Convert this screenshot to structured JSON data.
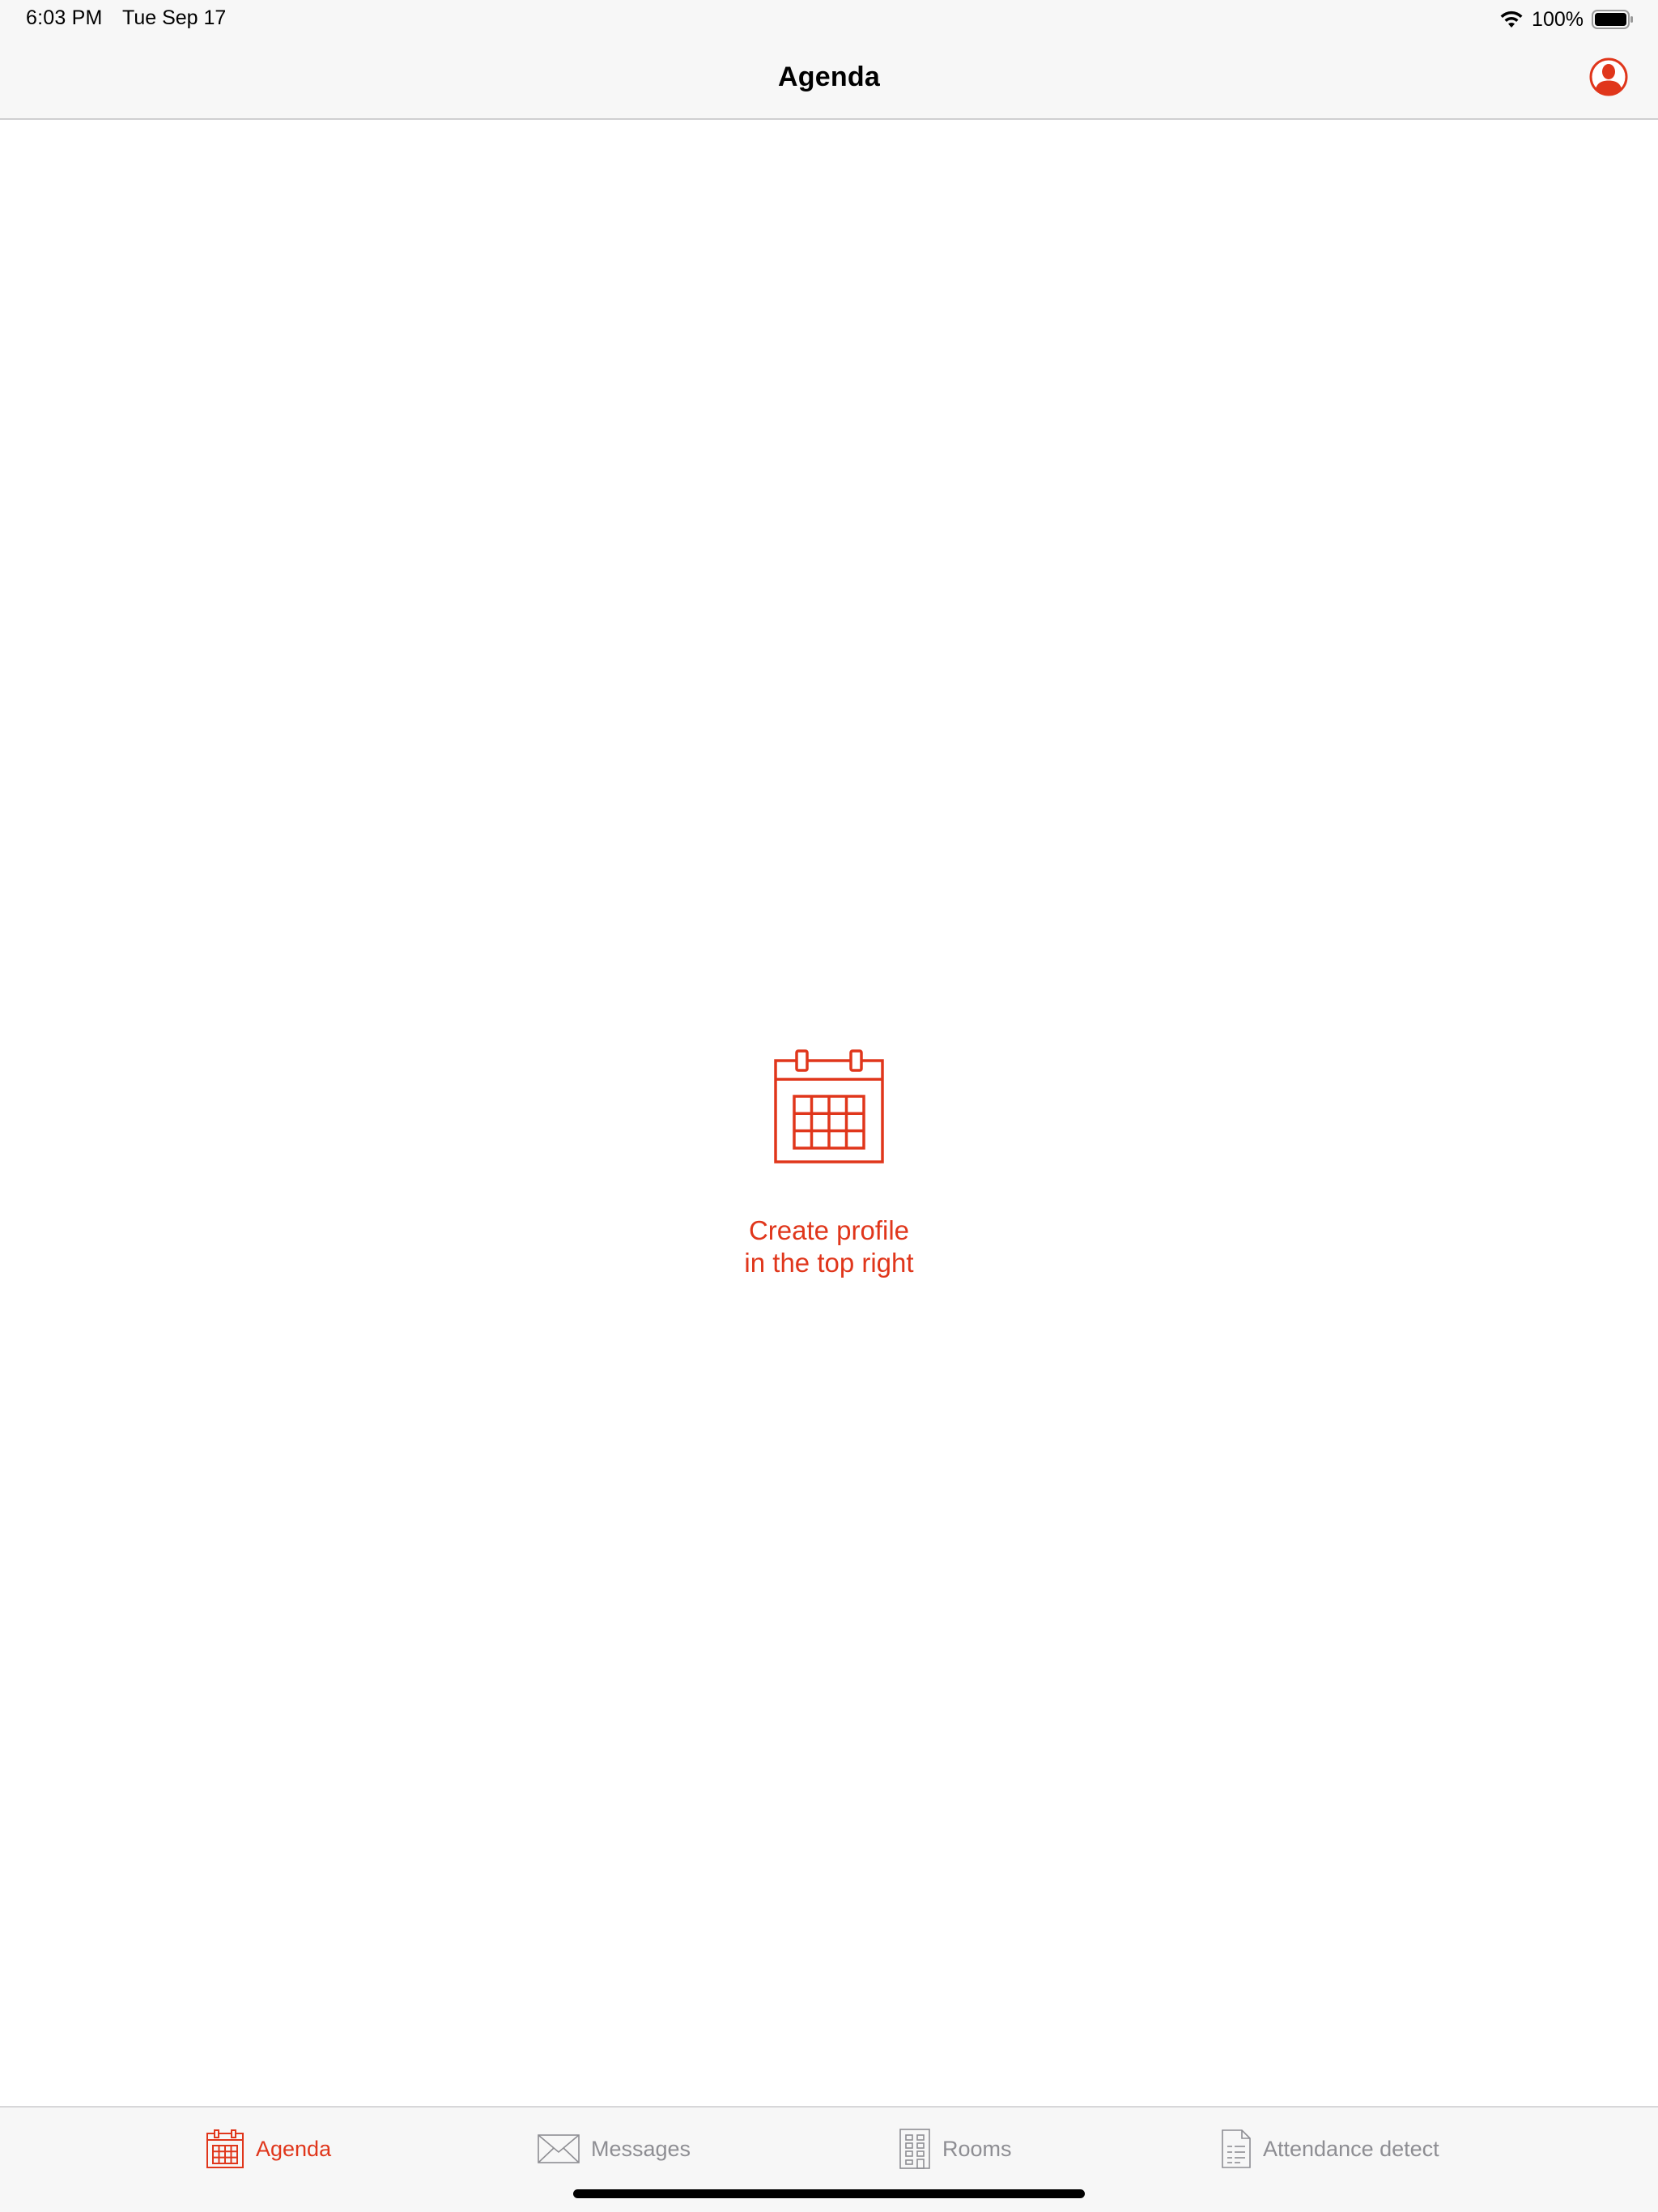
{
  "status_bar": {
    "time": "6:03 PM",
    "date": "Tue Sep 17",
    "battery_percent": "100%",
    "wifi_icon": "wifi-icon",
    "battery_icon": "battery-full-icon"
  },
  "nav": {
    "title": "Agenda",
    "profile_icon": "profile-icon"
  },
  "empty_state": {
    "icon": "calendar-icon",
    "line1": "Create profile",
    "line2": "in the top right"
  },
  "tabs": [
    {
      "label": "Agenda",
      "icon": "calendar-icon",
      "active": true
    },
    {
      "label": "Messages",
      "icon": "envelope-icon",
      "active": false
    },
    {
      "label": "Rooms",
      "icon": "building-icon",
      "active": false
    },
    {
      "label": "Attendance detect",
      "icon": "document-icon",
      "active": false
    }
  ],
  "colors": {
    "accent": "#e0361b",
    "inactive": "#8e8e93",
    "bar_background": "#f7f7f7"
  }
}
